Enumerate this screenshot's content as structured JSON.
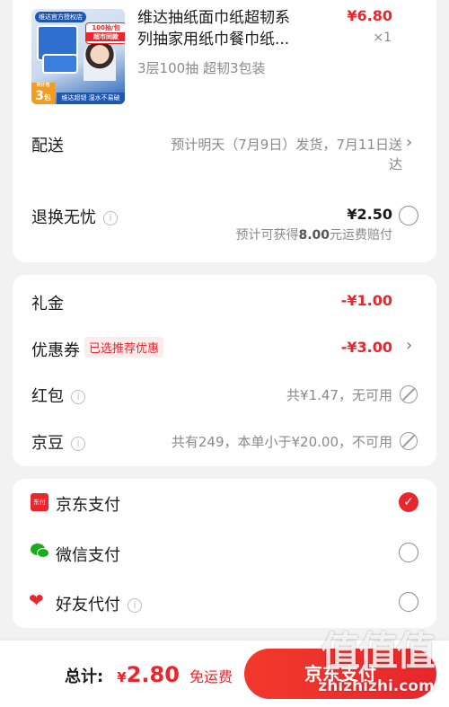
{
  "product": {
    "title_line1": "维达抽纸面巾纸超韧系",
    "title_line2": "列抽家用纸巾餐巾纸...",
    "price": "¥6.80",
    "qty": "×1",
    "spec": "3层100抽 超韧3包装",
    "thumb": {
      "shop_tag": "维达官方授权店",
      "badge_line1": "100抽/包",
      "badge_line2": "超市同款",
      "count_small": "共计包",
      "count": "3",
      "count_unit": "包",
      "slogan": "维达超韧 湿水不易破"
    }
  },
  "delivery": {
    "label": "配送",
    "text_line1": "预计明天（7月9日）发货，7月11日送",
    "text_line2": "达"
  },
  "returns": {
    "label": "退换无忧",
    "price": "¥2.50",
    "note_prefix": "预计可获得",
    "note_amount": "8.00",
    "note_suffix": "元运费赔付"
  },
  "discounts": {
    "gift": {
      "label": "礼金",
      "value": "-¥1.00"
    },
    "coupon": {
      "label": "优惠券",
      "tag": "已选推荐优惠",
      "value": "-¥3.00"
    },
    "redpacket": {
      "label": "红包",
      "value": "共¥1.47，无可用"
    },
    "jdbean": {
      "label": "京豆",
      "value": "共有249，本单小于¥20.00，不可用"
    }
  },
  "payment": {
    "jd": {
      "label": "京东支付",
      "selected": true,
      "icon_text": "东付"
    },
    "wechat": {
      "label": "微信支付",
      "selected": false
    },
    "friend": {
      "label": "好友代付",
      "selected": false
    }
  },
  "footer": {
    "total_label": "总计:",
    "currency": "¥",
    "amount": "2.80",
    "free_shipping": "免运费",
    "pay_button": "京东支付"
  },
  "watermark": {
    "logo": "值",
    "site": "zhizhizhi.com"
  },
  "colors": {
    "accent": "#e8262c",
    "wechat": "#1aad19",
    "background": "#f2f2f2"
  }
}
